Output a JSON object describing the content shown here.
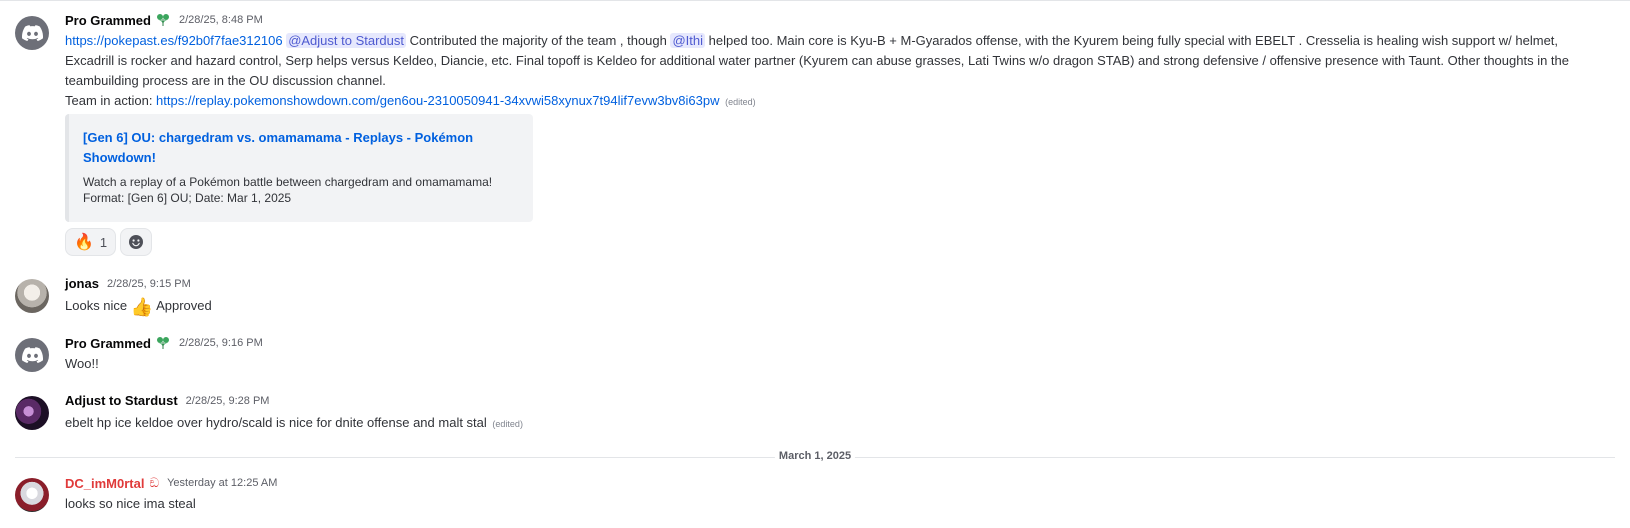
{
  "messages": [
    {
      "author": "Pro Grammed",
      "timestamp": "2/28/25, 8:48 PM",
      "link1": "https://pokepast.es/f92b0f7fae312106",
      "mention1": "@Adjust to Stardust",
      "text1": " Contributed the majority of the team , though ",
      "mention2": "@Ithi",
      "text2": " helped too. Main core is Kyu-B + M-Gyarados offense, with the Kyurem being fully special with EBELT . Cresselia is healing wish support w/ helmet, Excadrill is rocker and hazard control, Serp helps versus Keldeo, Diancie, etc. Final topoff is Keldeo for additional water partner (Kyurem can abuse grasses, Lati Twins w/o dragon STAB) and strong defensive / offensive presence with Taunt. Other thoughts in the teambuilding process are in the OU discussion channel.",
      "line2_prefix": "Team in action: ",
      "link2": "https://replay.pokemonshowdown.com/gen6ou-2310050941-34xvwi58xynux7t94lif7evw3bv8i63pw",
      "edited": "(edited)",
      "embed": {
        "title": "[Gen 6] OU: chargedram vs. omamamama - Replays - Pokémon Showdown!",
        "description_line1": "Watch a replay of a Pokémon battle between chargedram and omamamama!",
        "description_line2": "Format: [Gen 6] OU; Date: Mar 1, 2025"
      },
      "reactions": [
        {
          "emoji": "🔥",
          "count": "1"
        }
      ]
    },
    {
      "author": "jonas",
      "timestamp": "2/28/25, 9:15 PM",
      "text_before": "Looks nice ",
      "emoji": "👍",
      "text_after": " Approved"
    },
    {
      "author": "Pro Grammed",
      "timestamp": "2/28/25, 9:16 PM",
      "text": "Woo!!"
    },
    {
      "author": "Adjust to Stardust",
      "timestamp": "2/28/25, 9:28 PM",
      "text": "ebelt hp ice keldoe over hydro/scald is nice for dnite offense and malt stal",
      "edited": "(edited)"
    },
    {
      "author": "DC_imM0rtal",
      "role_glyph": "ඞ",
      "timestamp": "Yesterday at 12:25 AM",
      "text": "looks so nice ima steal"
    }
  ],
  "divider": {
    "label": "March 1, 2025"
  },
  "colors": {
    "link": "#0060df",
    "mention_bg": "#e6e8fd",
    "mention_text": "#4e5ad0",
    "role_green": "#3ba55d",
    "username_red": "#e03a3a"
  },
  "icons": {
    "avatar_default": "discord-logo-icon",
    "role_icon": "leaf-role-icon",
    "add_reaction": "add-reaction-smile-icon"
  }
}
